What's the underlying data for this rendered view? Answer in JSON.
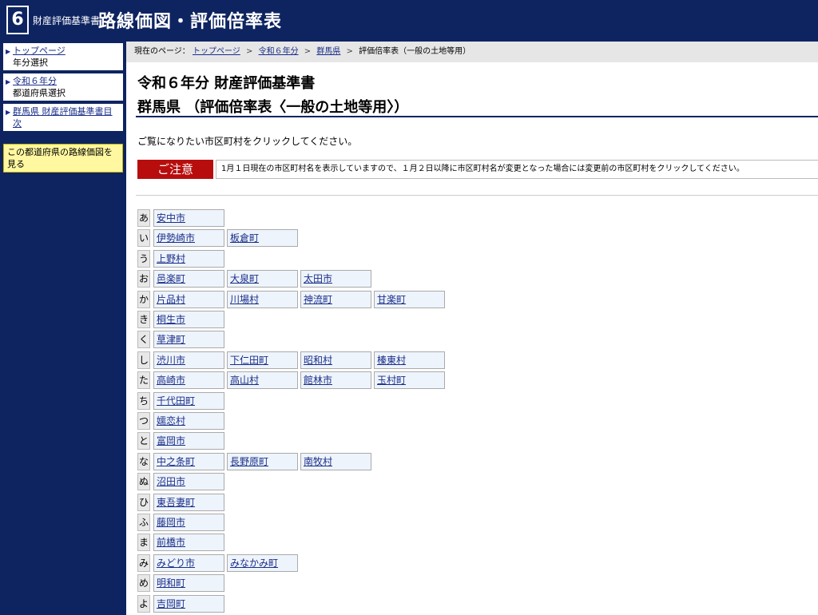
{
  "header": {
    "logo_number": "6",
    "small_title": "財産評価基準書",
    "big_title": "路線価図・評価倍率表"
  },
  "sidebar": {
    "items": [
      {
        "link": "トップページ",
        "sub": "年分選択"
      },
      {
        "link": "令和６年分",
        "sub": "都道府県選択"
      },
      {
        "link": "群馬県 財産評価基準書目次",
        "sub": ""
      }
    ],
    "notice": "この都道府県の路線価図を見る"
  },
  "breadcrumb": {
    "prefix": "現在のページ：",
    "items": [
      "トップページ",
      "令和６年分",
      "群馬県"
    ],
    "current": "評価倍率表（一般の土地等用）"
  },
  "main": {
    "title1": "令和６年分 財産評価基準書",
    "title2": "群馬県 （評価倍率表〈一般の土地等用〉）",
    "instruction": "ご覧になりたい市区町村をクリックしてください。",
    "notice_label": "ご注意",
    "notice_text": "1月１日現在の市区町村名を表示していますので、１月２日以降に市区町村名が変更となった場合には変更前の市区町村をクリックしてください。"
  },
  "rows": [
    {
      "kana": "あ",
      "cities": [
        "安中市"
      ]
    },
    {
      "kana": "い",
      "cities": [
        "伊勢崎市",
        "板倉町"
      ]
    },
    {
      "kana": "う",
      "cities": [
        "上野村"
      ]
    },
    {
      "kana": "お",
      "cities": [
        "邑楽町",
        "大泉町",
        "太田市"
      ]
    },
    {
      "kana": "か",
      "cities": [
        "片品村",
        "川場村",
        "神流町",
        "甘楽町"
      ]
    },
    {
      "kana": "き",
      "cities": [
        "桐生市"
      ]
    },
    {
      "kana": "く",
      "cities": [
        "草津町"
      ]
    },
    {
      "kana": "し",
      "cities": [
        "渋川市",
        "下仁田町",
        "昭和村",
        "榛東村"
      ]
    },
    {
      "kana": "た",
      "cities": [
        "高崎市",
        "高山村",
        "館林市",
        "玉村町"
      ]
    },
    {
      "kana": "ち",
      "cities": [
        "千代田町"
      ]
    },
    {
      "kana": "つ",
      "cities": [
        "嬬恋村"
      ]
    },
    {
      "kana": "と",
      "cities": [
        "富岡市"
      ]
    },
    {
      "kana": "な",
      "cities": [
        "中之条町",
        "長野原町",
        "南牧村"
      ]
    },
    {
      "kana": "ぬ",
      "cities": [
        "沼田市"
      ]
    },
    {
      "kana": "ひ",
      "cities": [
        "東吾妻町"
      ]
    },
    {
      "kana": "ふ",
      "cities": [
        "藤岡市"
      ]
    },
    {
      "kana": "ま",
      "cities": [
        "前橋市"
      ]
    },
    {
      "kana": "み",
      "cities": [
        "みどり市",
        "みなかみ町"
      ]
    },
    {
      "kana": "め",
      "cities": [
        "明和町"
      ]
    },
    {
      "kana": "よ",
      "cities": [
        "吉岡町"
      ]
    }
  ]
}
